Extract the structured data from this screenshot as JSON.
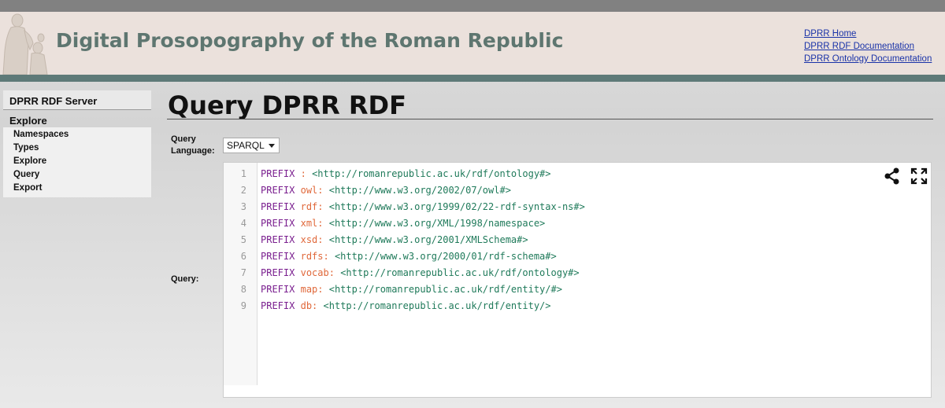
{
  "header": {
    "site_title": "Digital Prosopography of the Roman Republic",
    "links": [
      "DPRR Home",
      "DPRR RDF Documentation",
      "DPRR Ontology Documentation"
    ]
  },
  "sidebar": {
    "title": "DPRR RDF Server",
    "section": "Explore",
    "items": [
      "Namespaces",
      "Types",
      "Explore",
      "Query",
      "Export"
    ]
  },
  "main": {
    "title": "Query DPRR RDF",
    "query_language_label": "Query Language:",
    "query_language_value": "SPARQL",
    "query_label": "Query:"
  },
  "editor": {
    "lines": [
      {
        "n": "1",
        "kw": "PREFIX",
        "prefix": ":",
        "iri": "<http://romanrepublic.ac.uk/rdf/ontology#>"
      },
      {
        "n": "2",
        "kw": "PREFIX",
        "prefix": "owl:",
        "iri": "<http://www.w3.org/2002/07/owl#>"
      },
      {
        "n": "3",
        "kw": "PREFIX",
        "prefix": "rdf:",
        "iri": "<http://www.w3.org/1999/02/22-rdf-syntax-ns#>"
      },
      {
        "n": "4",
        "kw": "PREFIX",
        "prefix": "xml:",
        "iri": "<http://www.w3.org/XML/1998/namespace>"
      },
      {
        "n": "5",
        "kw": "PREFIX",
        "prefix": "xsd:",
        "iri": "<http://www.w3.org/2001/XMLSchema#>"
      },
      {
        "n": "6",
        "kw": "PREFIX",
        "prefix": "rdfs:",
        "iri": "<http://www.w3.org/2000/01/rdf-schema#>"
      },
      {
        "n": "7",
        "kw": "PREFIX",
        "prefix": "vocab:",
        "iri": "<http://romanrepublic.ac.uk/rdf/ontology#>"
      },
      {
        "n": "8",
        "kw": "PREFIX",
        "prefix": "map:",
        "iri": "<http://romanrepublic.ac.uk/rdf/entity/#>"
      },
      {
        "n": "9",
        "kw": "PREFIX",
        "prefix": "db:",
        "iri": "<http://romanrepublic.ac.uk/rdf/entity/>"
      }
    ],
    "icons": [
      "share-icon",
      "fullscreen-icon"
    ]
  }
}
